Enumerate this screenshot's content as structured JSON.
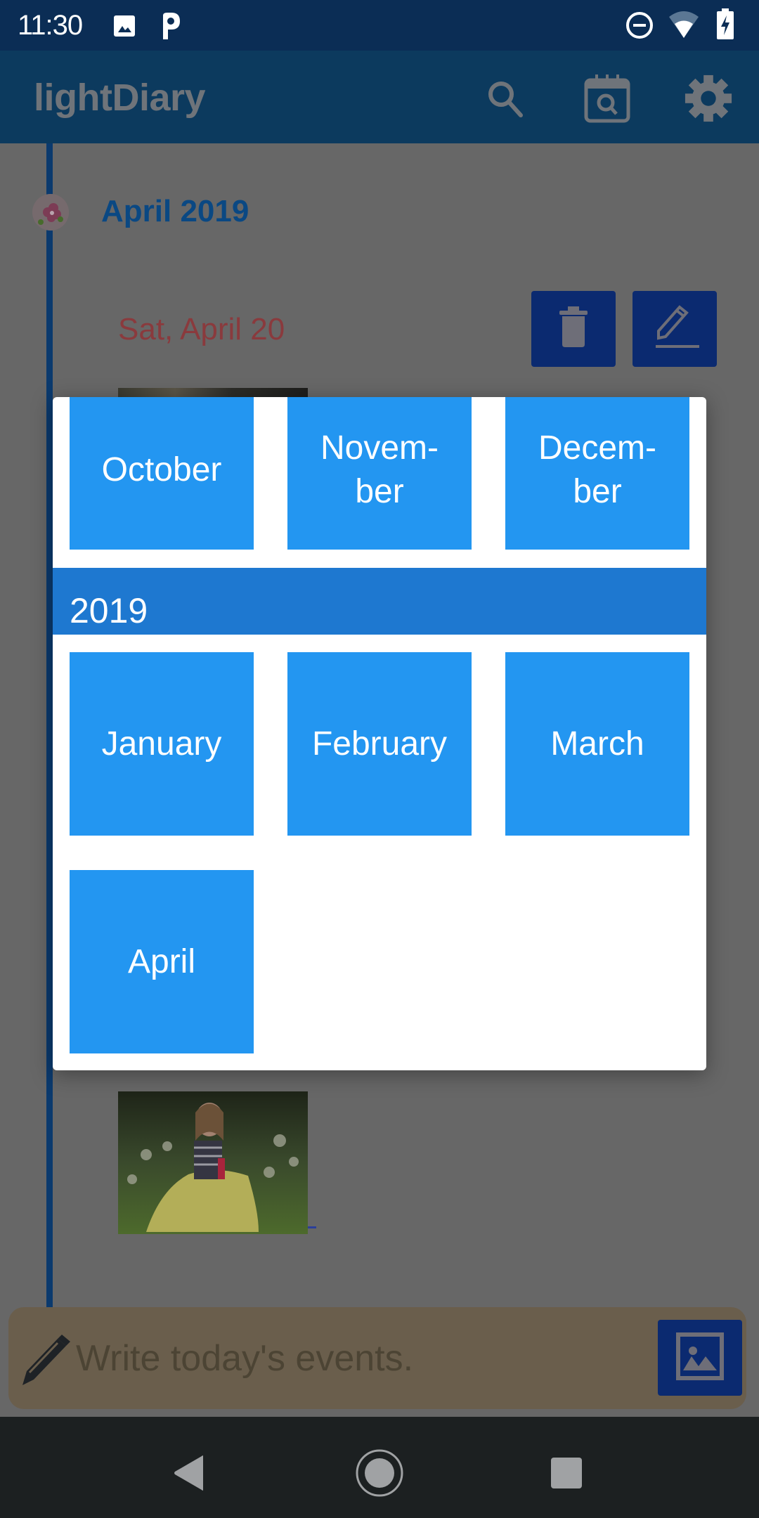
{
  "status_bar": {
    "time": "11:30",
    "left_icons": [
      "gallery-notification-icon",
      "parking-notification-icon"
    ],
    "right_icons": [
      "do-not-disturb-icon",
      "wifi-icon",
      "battery-charging-icon"
    ]
  },
  "app_bar": {
    "title": "lightDiary",
    "actions": [
      "search-icon",
      "calendar-search-icon",
      "settings-gear-icon"
    ]
  },
  "timeline": {
    "month_heading": "April 2019",
    "entry": {
      "date": "Sat, April 20",
      "actions": [
        "delete-icon",
        "edit-icon"
      ]
    }
  },
  "month_picker": {
    "previous_year_months": [
      {
        "label": "October"
      },
      {
        "label": "Novem-\nber"
      },
      {
        "label": "Decem-\nber"
      }
    ],
    "year": "2019",
    "months": [
      {
        "label": "January"
      },
      {
        "label": "February"
      },
      {
        "label": "March"
      },
      {
        "label": "April"
      }
    ]
  },
  "composer": {
    "placeholder": "Write today's events.",
    "value": ""
  },
  "colors": {
    "tile_blue": "#2396f1",
    "year_band": "#1e78d0",
    "status_bar": "#0b2d55",
    "app_bar_dimmed": "#0c3a5e",
    "scrim": "#676767",
    "date_red": "#8a3a3d",
    "button_navy": "#0b2a70"
  }
}
